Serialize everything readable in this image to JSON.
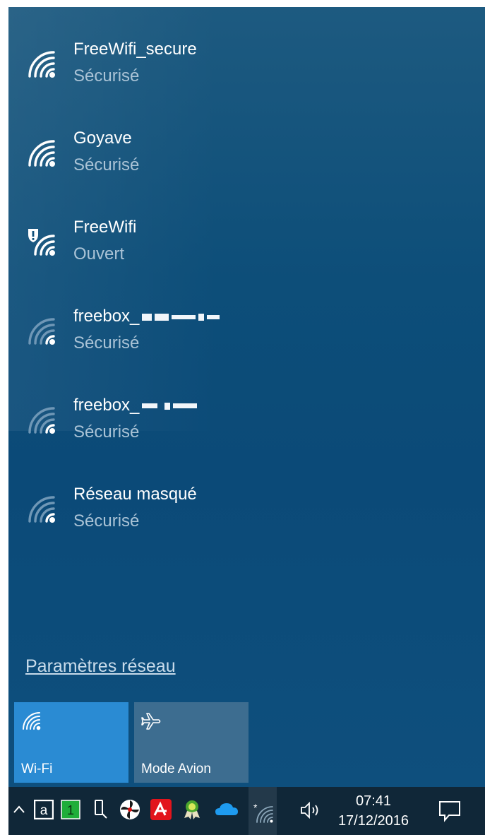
{
  "networks": [
    {
      "name": "FreeWifi_secure",
      "status": "Sécurisé",
      "icon": "wifi-signal-strong-icon"
    },
    {
      "name": "Goyave",
      "status": "Sécurisé",
      "icon": "wifi-signal-strong-icon"
    },
    {
      "name": "FreeWifi",
      "status": "Ouvert",
      "icon": "wifi-open-warning-icon"
    },
    {
      "name": "freebox_",
      "status": "Sécurisé",
      "icon": "wifi-signal-weak-icon"
    },
    {
      "name": "freebox_",
      "status": "Sécurisé",
      "icon": "wifi-signal-weak-icon"
    },
    {
      "name": "Réseau masqué",
      "status": "Sécurisé",
      "icon": "wifi-signal-weak-icon"
    }
  ],
  "settings_link": "Paramètres réseau",
  "quick_actions": [
    {
      "label": "Wi-Fi",
      "icon": "wifi-icon",
      "active": true
    },
    {
      "label": "Mode Avion",
      "icon": "airplane-icon",
      "active": false
    }
  ],
  "taskbar": {
    "time": "07:41",
    "date": "17/12/2016",
    "tray_icons": [
      "chevron-up-icon",
      "amazon-icon",
      "green-one-icon",
      "usb-icon",
      "fan-icon",
      "avira-icon",
      "ribbon-icon",
      "onedrive-icon",
      "wifi-tray-icon",
      "volume-icon",
      "action-center-icon"
    ]
  },
  "colors": {
    "flyout_bg": "#0b4a78",
    "tile_active": "#2a8bd3",
    "tile_inactive": "#3d6d90",
    "taskbar_bg": "#102738"
  }
}
